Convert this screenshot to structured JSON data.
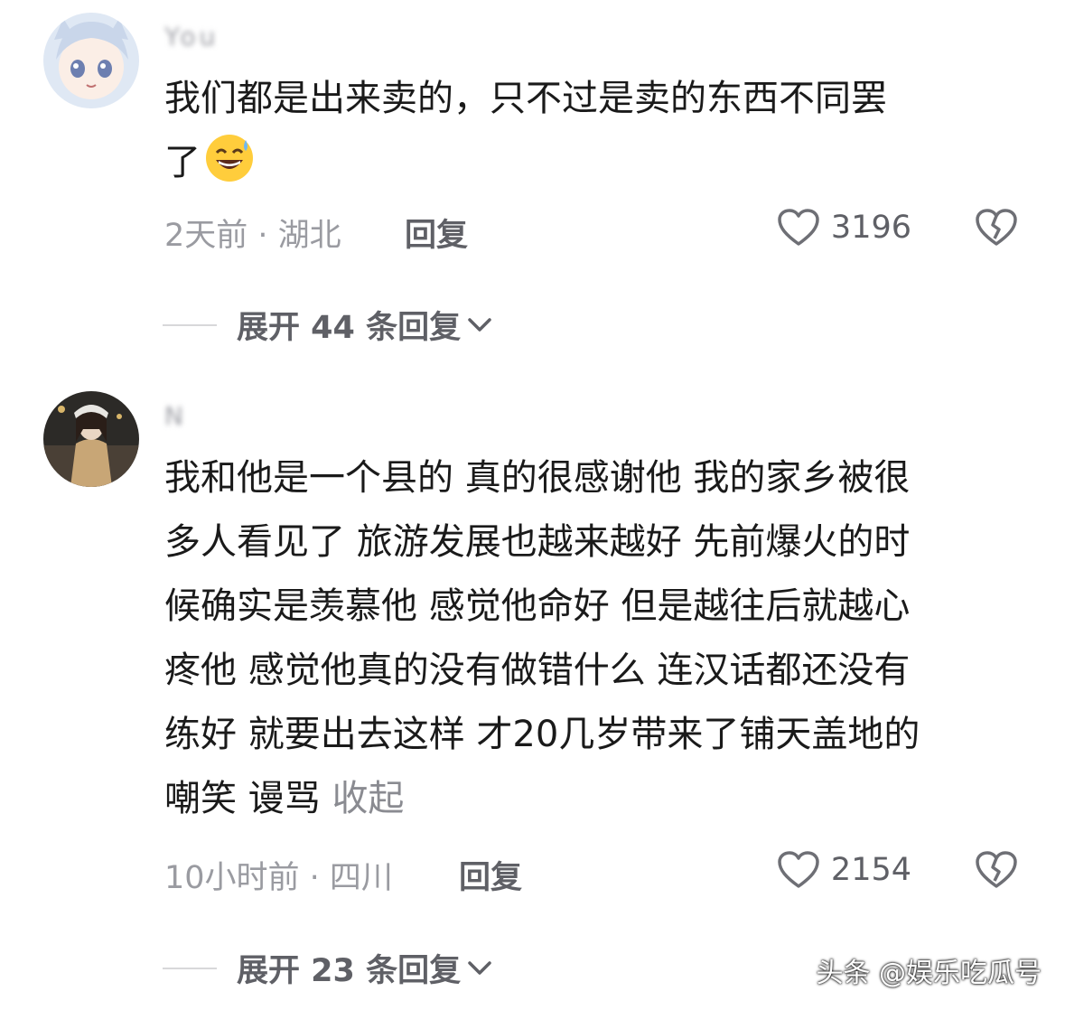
{
  "comments": [
    {
      "username": "You",
      "text_line1": "我们都是出来卖的，只不过是卖的东西不同罢",
      "text_line2": "了",
      "emoji": "grinning-face-with-sweat-emoji",
      "time_location": "2天前 · 湖北",
      "reply_label": "回复",
      "likes": "3196",
      "expand_label": "展开 44 条回复"
    },
    {
      "username": "N",
      "text_lines": [
        "我和他是一个县的 真的很感谢他 我的家乡被很",
        "多人看见了 旅游发展也越来越好 先前爆火的时",
        "候确实是羡慕他 感觉他命好 但是越往后就越心",
        "疼他 感觉他真的没有做错什么 连汉话都还没有",
        "练好 就要出去这样 才20几岁带来了铺天盖地的"
      ],
      "text_last": "嘲笑 谩骂 ",
      "collapse_label": "收起",
      "time_location": "10小时前 · 四川",
      "reply_label": "回复",
      "likes": "2154",
      "expand_label": "展开 23 条回复"
    }
  ],
  "watermark": "头条 @娱乐吃瓜号"
}
